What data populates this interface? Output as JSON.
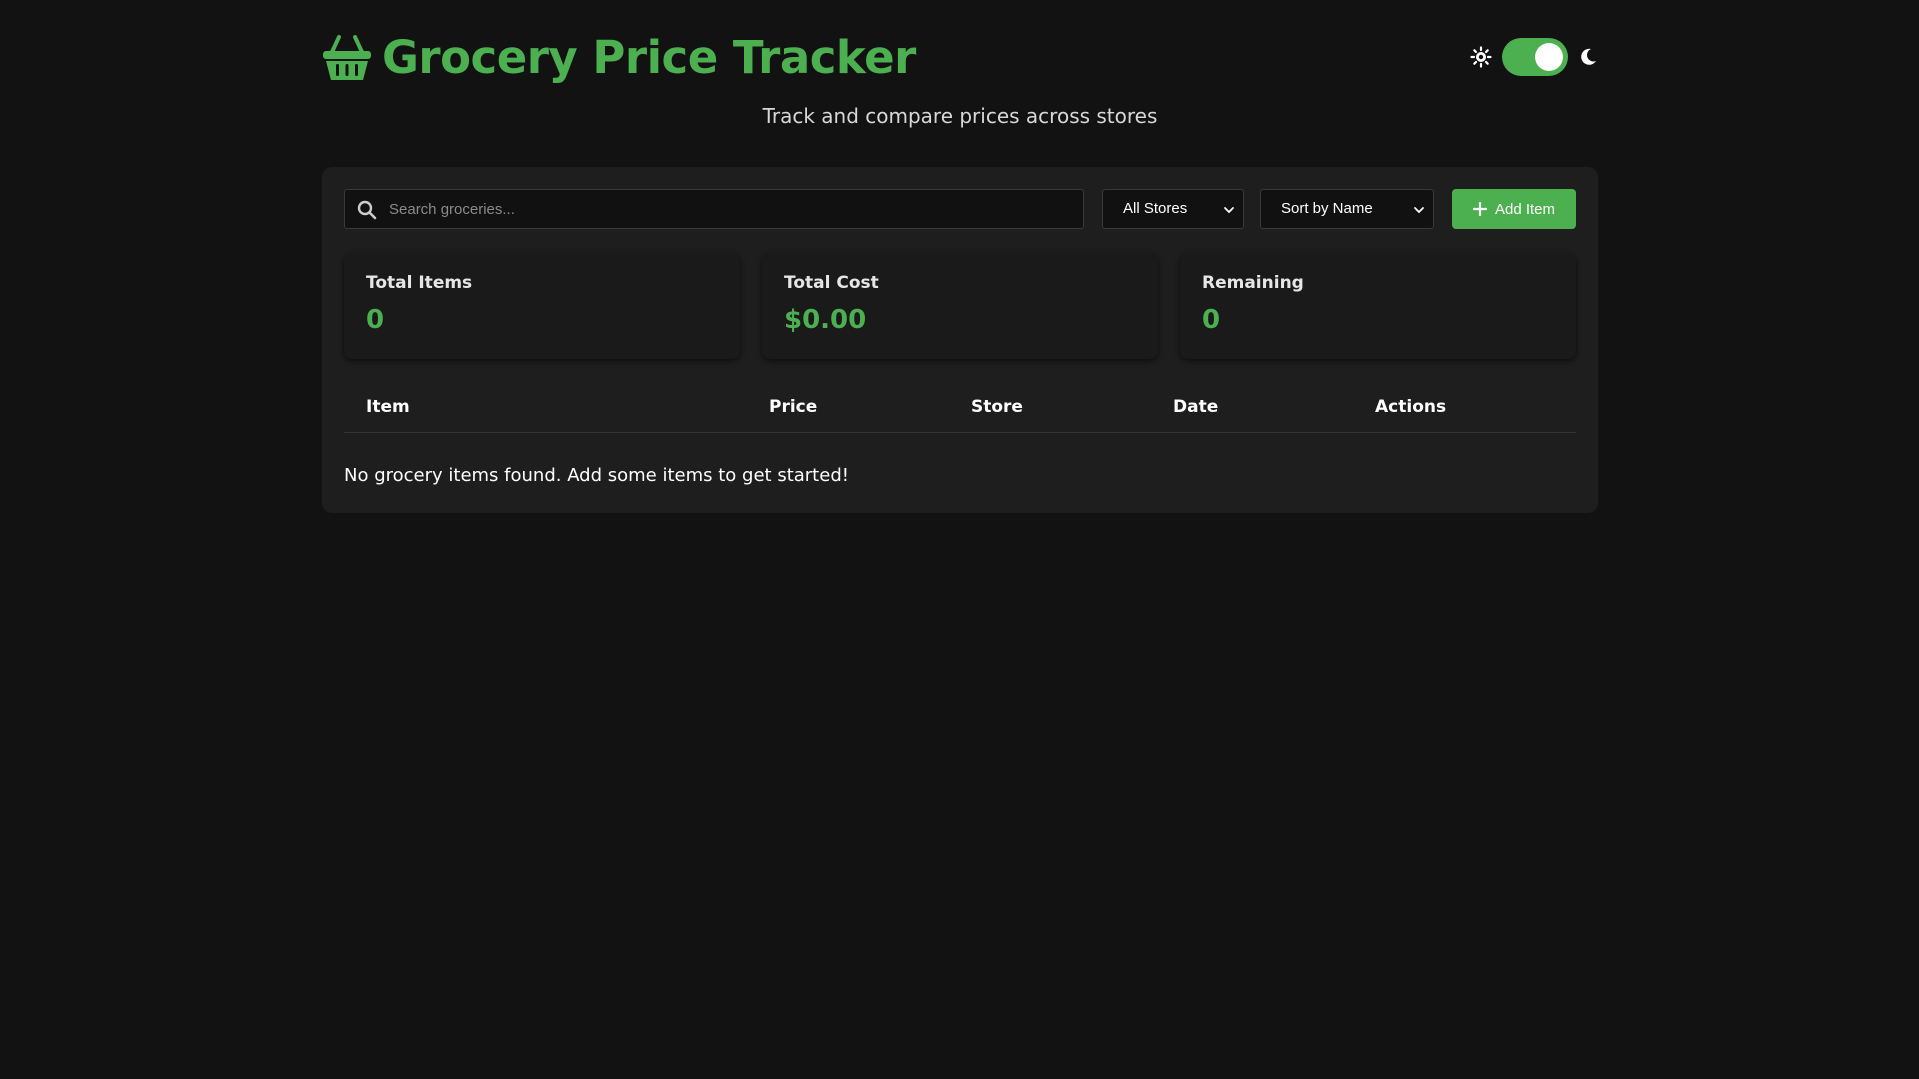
{
  "header": {
    "title": "Grocery Price Tracker",
    "subtitle": "Track and compare prices across stores",
    "brand_icon": "basket-icon",
    "theme_toggle": {
      "light_icon": "sun-icon",
      "dark_icon": "moon-icon",
      "state": "dark"
    }
  },
  "toolbar": {
    "search_placeholder": "Search groceries...",
    "search_value": "",
    "store_filter": "All Stores",
    "sort": "Sort by Name",
    "add_label": "Add Item"
  },
  "stats": [
    {
      "label": "Total Items",
      "value": "0"
    },
    {
      "label": "Total Cost",
      "value": "$0.00"
    },
    {
      "label": "Remaining",
      "value": "0"
    }
  ],
  "table": {
    "columns": [
      "Item",
      "Price",
      "Store",
      "Date",
      "Actions"
    ],
    "rows": [],
    "empty_message": "No grocery items found. Add some items to get started!"
  },
  "colors": {
    "accent": "#4caf50",
    "background": "#121212",
    "panel": "#1e1e1e"
  }
}
